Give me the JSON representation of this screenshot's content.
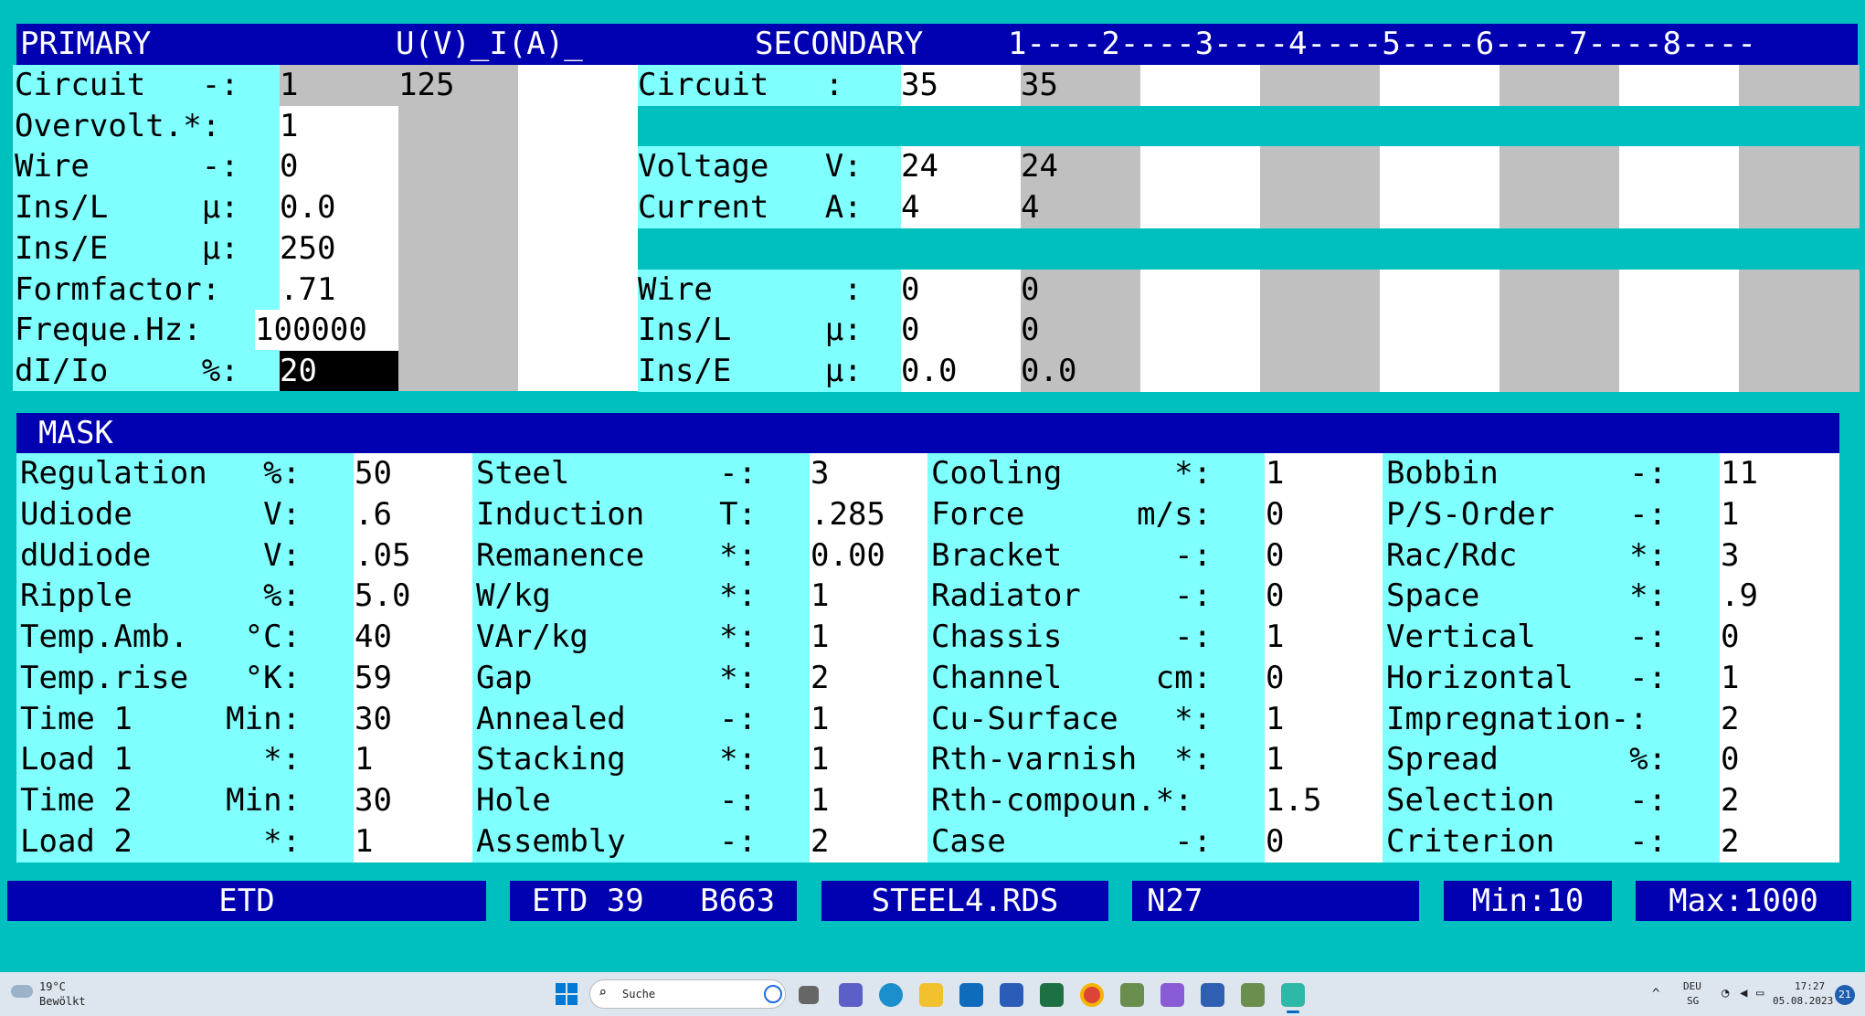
{
  "primary": {
    "header": {
      "title": "PRIMARY",
      "uv": "U(V)_I(A)_"
    },
    "rows": [
      {
        "label": "Circuit   -:",
        "value": "1",
        "extra": "125"
      },
      {
        "label": "Overvolt.*:",
        "value": "1"
      },
      {
        "label": "Wire      -:",
        "value": "0"
      },
      {
        "label": "Ins/L     µ:",
        "value": "0.0"
      },
      {
        "label": "Ins/E     µ:",
        "value": "250"
      },
      {
        "label": "Formfactor:",
        "value": ".71"
      },
      {
        "label": "Freque.Hz:",
        "value": "100000"
      },
      {
        "label": "dI/Io     %:",
        "value": "20"
      }
    ]
  },
  "secondary": {
    "header": {
      "title": "SECONDARY",
      "ruler": "1----2----3----4----5----6----7----8----"
    },
    "rows": [
      {
        "label": "Circuit   :",
        "v1": "35",
        "v2": "35"
      },
      {
        "label": "",
        "v1": "",
        "v2": ""
      },
      {
        "label": "Voltage   V:",
        "v1": "24",
        "v2": "24"
      },
      {
        "label": "Current   A:",
        "v1": "4",
        "v2": "4"
      },
      {
        "label": "",
        "v1": "",
        "v2": ""
      },
      {
        "label": "Wire       :",
        "v1": "0",
        "v2": "0"
      },
      {
        "label": "Ins/L     µ:",
        "v1": "0",
        "v2": "0"
      },
      {
        "label": "Ins/E     µ:",
        "v1": "0.0",
        "v2": "0.0"
      }
    ]
  },
  "mask": {
    "title": "MASK",
    "columns": [
      [
        {
          "label": "Regulation   %:",
          "value": "50"
        },
        {
          "label": "Udiode       V:",
          "value": ".6"
        },
        {
          "label": "dUdiode      V:",
          "value": ".05"
        },
        {
          "label": "Ripple       %:",
          "value": "5.0"
        },
        {
          "label": "Temp.Amb.   °C:",
          "value": "40"
        },
        {
          "label": "Temp.rise   °K:",
          "value": "59"
        },
        {
          "label": "Time 1     Min:",
          "value": "30"
        },
        {
          "label": "Load 1       *:",
          "value": "1"
        },
        {
          "label": "Time 2     Min:",
          "value": "30"
        },
        {
          "label": "Load 2       *:",
          "value": "1"
        }
      ],
      [
        {
          "label": "Steel        -:",
          "value": "3"
        },
        {
          "label": "Induction    T:",
          "value": ".285"
        },
        {
          "label": "Remanence    *:",
          "value": "0.00"
        },
        {
          "label": "W/kg         *:",
          "value": "1"
        },
        {
          "label": "VAr/kg       *:",
          "value": "1"
        },
        {
          "label": "Gap          *:",
          "value": "2"
        },
        {
          "label": "Annealed     -:",
          "value": "1"
        },
        {
          "label": "Stacking     *:",
          "value": "1"
        },
        {
          "label": "Hole         -:",
          "value": "1"
        },
        {
          "label": "Assembly     -:",
          "value": "2"
        }
      ],
      [
        {
          "label": "Cooling      *:",
          "value": "1"
        },
        {
          "label": "Force      m/s:",
          "value": "0"
        },
        {
          "label": "Bracket      -:",
          "value": "0"
        },
        {
          "label": "Radiator     -:",
          "value": "0"
        },
        {
          "label": "Chassis      -:",
          "value": "1"
        },
        {
          "label": "Channel     cm:",
          "value": "0"
        },
        {
          "label": "Cu-Surface   *:",
          "value": "1"
        },
        {
          "label": "Rth-varnish  *:",
          "value": "1"
        },
        {
          "label": "Rth-compoun.*:",
          "value": "1.5"
        },
        {
          "label": "Case         -:",
          "value": "0"
        }
      ],
      [
        {
          "label": "Bobbin       -:",
          "value": "11"
        },
        {
          "label": "P/S-Order    -:",
          "value": "1"
        },
        {
          "label": "Rac/Rdc      *:",
          "value": "3"
        },
        {
          "label": "Space        *:",
          "value": ".9"
        },
        {
          "label": "Vertical     -:",
          "value": "0"
        },
        {
          "label": "Horizontal   -:",
          "value": "1"
        },
        {
          "label": "Impregnation-:",
          "value": "2"
        },
        {
          "label": "Spread       %:",
          "value": "0"
        },
        {
          "label": "Selection    -:",
          "value": "2"
        },
        {
          "label": "Criterion    -:",
          "value": "2"
        }
      ]
    ]
  },
  "footer": [
    "ETD",
    "ETD 39   B663",
    "STEEL4.RDS",
    "N27",
    "Min:10",
    "Max:1000"
  ],
  "taskbar": {
    "weather_temp": "19°C",
    "weather_desc": "Bewölkt",
    "search_placeholder": "Suche",
    "lang": "DEU",
    "lang_sub": "SG",
    "time": "17:27",
    "date": "05.08.2023",
    "notif_count": "21"
  },
  "colors": {
    "header_blue": "#0000B0",
    "teal": "#00BFBF",
    "cyan": "#80FFFF",
    "grey": "#C0C0C0"
  }
}
